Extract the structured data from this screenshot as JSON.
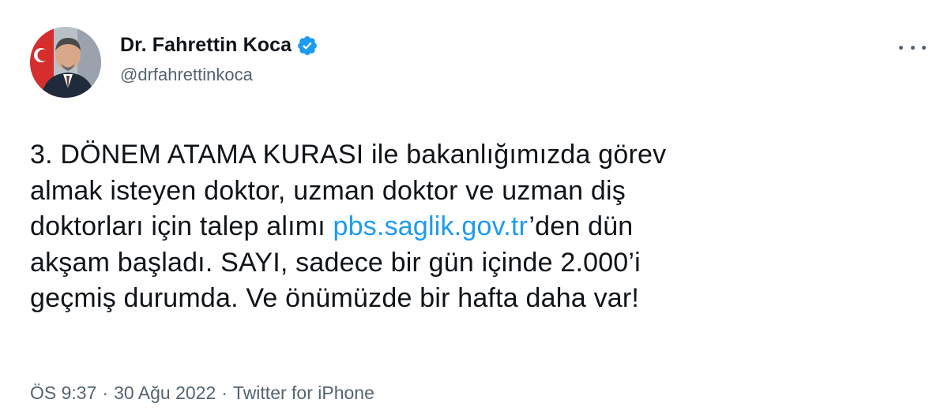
{
  "author": {
    "name": "Dr. Fahrettin Koca",
    "handle": "@drfahrettinkoca",
    "verified_color": "#1d9bf0"
  },
  "tweet": {
    "line1": "3. DÖNEM ATAMA KURASI ile bakanlığımızda görev",
    "line2": "almak isteyen doktor, uzman doktor ve uzman diş",
    "line3_before": "doktorları için talep alımı ",
    "link_text": "pbs.saglik.gov.tr",
    "line3_after": "’den dün",
    "line4": "akşam başladı. SAYI, sadece bir gün içinde 2.000’i",
    "line5": "geçmiş durumda. Ve önümüzde bir hafta daha var!"
  },
  "meta": {
    "time": "ÖS 9:37",
    "separator": "·",
    "date": "30 Ağu 2022",
    "source": "Twitter for iPhone"
  },
  "icons": {
    "more": "more-horizontal-icon",
    "verified": "verified-badge-icon"
  }
}
